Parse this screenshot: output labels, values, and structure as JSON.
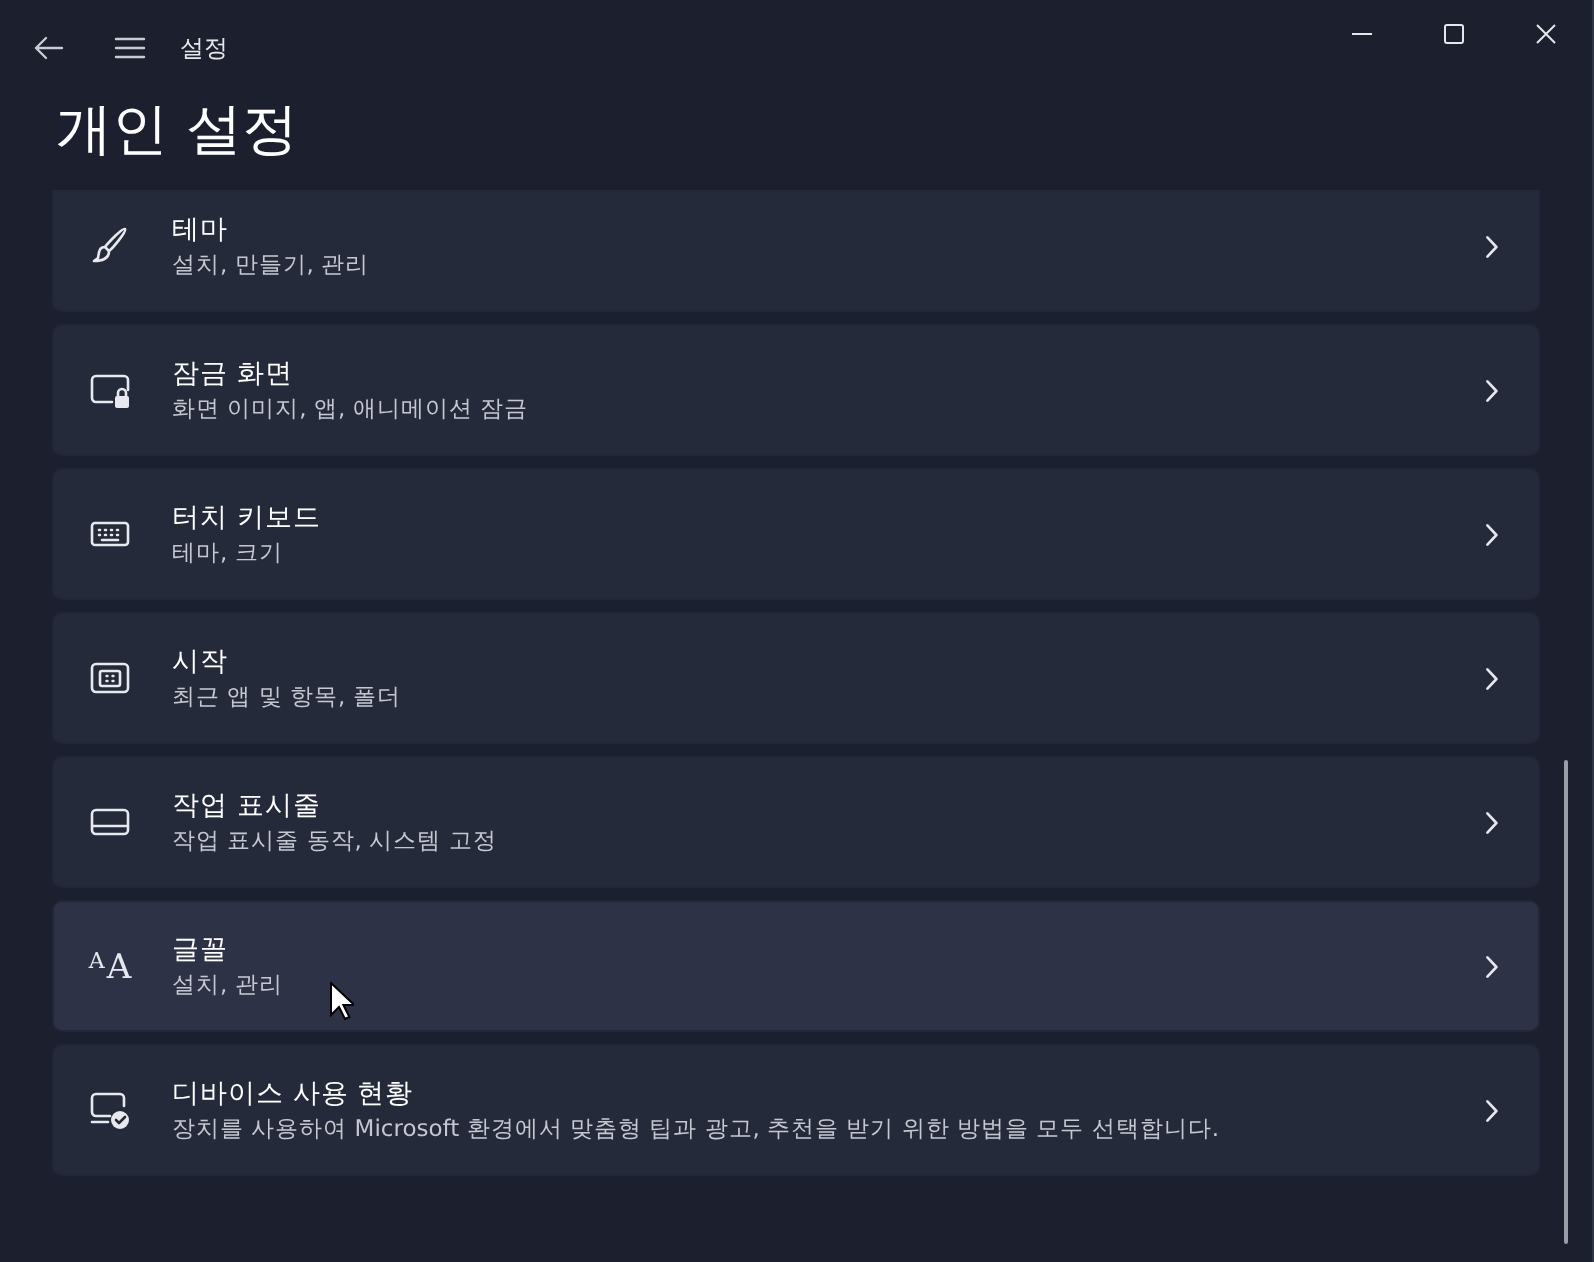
{
  "window": {
    "title": "설정"
  },
  "page": {
    "title": "개인 설정"
  },
  "items": [
    {
      "title": "테마",
      "subtitle": "설치, 만들기, 관리",
      "hovered": false
    },
    {
      "title": "잠금 화면",
      "subtitle": "화면 이미지, 앱, 애니메이션 잠금",
      "hovered": false
    },
    {
      "title": "터치 키보드",
      "subtitle": "테마, 크기",
      "hovered": false
    },
    {
      "title": "시작",
      "subtitle": "최근 앱 및 항목, 폴더",
      "hovered": false
    },
    {
      "title": "작업 표시줄",
      "subtitle": "작업 표시줄 동작, 시스템 고정",
      "hovered": false
    },
    {
      "title": "글꼴",
      "subtitle": "설치, 관리",
      "hovered": true,
      "glyph": "AA"
    },
    {
      "title": "디바이스 사용 현황",
      "subtitle": "장치를 사용하여 Microsoft 환경에서 맞춤형 팁과 광고, 추천을 받기 위한 방법을 모두 선택합니다.",
      "hovered": false
    }
  ]
}
